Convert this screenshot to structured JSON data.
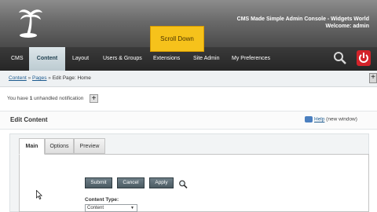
{
  "header": {
    "title": "CMS Made Simple Admin Console - Widgets World",
    "welcome": "Welcome: admin"
  },
  "overlay": {
    "scroll_label": "Scroll Down"
  },
  "nav": {
    "items": [
      "CMS",
      "Content",
      "Layout",
      "Users & Groups",
      "Extensions",
      "Site Admin",
      "My Preferences"
    ],
    "active": "Content"
  },
  "breadcrumb": {
    "content": "Content",
    "sep1": " » ",
    "pages": "Pages",
    "sep2": " » ",
    "current": "Edit Page: Home"
  },
  "notification": {
    "prefix": "You have ",
    "count": "1",
    "suffix": " unhandled notification",
    "toggle": "+"
  },
  "expand_toggle": "+",
  "edit": {
    "title": "Edit Content",
    "help_link": "Help",
    "help_note": " (new window)"
  },
  "tabs": [
    "Main",
    "Options",
    "Preview"
  ],
  "buttons": {
    "submit": "Submit",
    "cancel": "Cancel",
    "apply": "Apply"
  },
  "content_type": {
    "label": "Content Type:",
    "value": "Content"
  },
  "colors": {
    "accent": "#f6c21b",
    "nav_bg": "#2b2b2b",
    "link": "#1d5b8f"
  },
  "icons": [
    "palm-tree-logo-icon",
    "search-icon",
    "power-icon",
    "help-icon",
    "zoom-icon",
    "cursor-icon"
  ]
}
